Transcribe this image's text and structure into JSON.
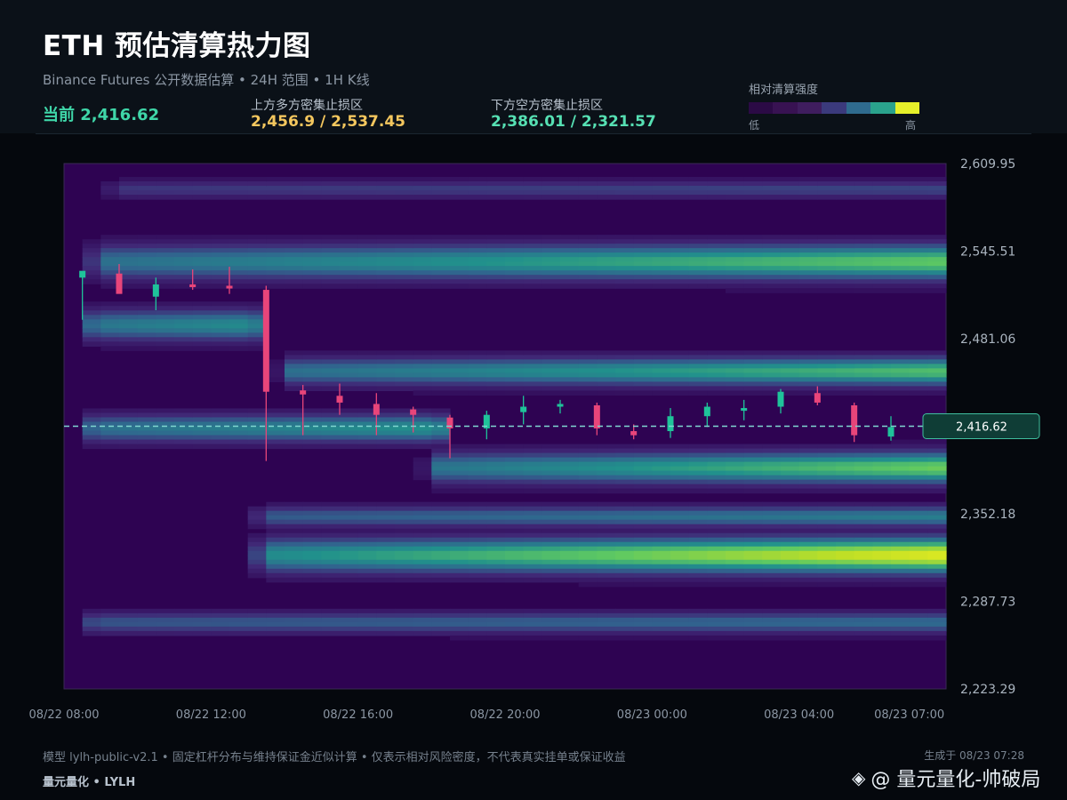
{
  "header": {
    "title": "ETH 预估清算热力图",
    "subtitle": "Binance Futures 公开数据估算 • 24H 范围 • 1H K线",
    "current_label": "当前 2,416.62",
    "upper_zone_label": "上方多方密集止损区",
    "upper_zone_value": "2,456.9 / 2,537.45",
    "lower_zone_label": "下方空方密集止损区",
    "lower_zone_value": "2,386.01 / 2,321.57"
  },
  "legend": {
    "title": "相对清算强度",
    "low": "低",
    "high": "高",
    "colors": [
      "#2b0a45",
      "#381252",
      "#3f1d5e",
      "#3b3a7c",
      "#2f6b8e",
      "#2aa28c",
      "#e6f02a"
    ]
  },
  "footer": {
    "note": "模型 lylh-public-v2.1 • 固定杠杆分布与维持保证金近似计算 • 仅表示相对风险密度，不代表真实挂单或保证收益",
    "brand": "量元量化 • LYLH",
    "generated": "生成于 08/23 07:28",
    "watermark": "@ 量元量化-帅破局"
  },
  "colors": {
    "up": "#1fc39a",
    "down": "#e8457a",
    "current_line": "#7fd6d0",
    "current_badge_bg": "#0f3d36"
  },
  "chart_data": {
    "type": "heatmap",
    "title": "ETH 预估清算热力图",
    "ylim": [
      2223.29,
      2609.95
    ],
    "y_ticks": [
      "2,609.95",
      "2,545.51",
      "2,481.06",
      "2,352.18",
      "2,287.73",
      "2,223.29"
    ],
    "y_tick_values": [
      2609.95,
      2545.51,
      2481.06,
      2352.18,
      2287.73,
      2223.29
    ],
    "x_ticks": [
      "08/22 08:00",
      "08/22 12:00",
      "08/22 16:00",
      "08/22 20:00",
      "08/23 00:00",
      "08/23 04:00",
      "08/23 07:00"
    ],
    "x_tick_hours": [
      0,
      4,
      8,
      12,
      16,
      20,
      23
    ],
    "current_price": 2416.62,
    "current_price_label": "2,416.62",
    "candles": [
      {
        "t": 0.5,
        "o": 2526,
        "h": 2528,
        "l": 2495,
        "c": 2531
      },
      {
        "t": 1.5,
        "o": 2529,
        "h": 2536,
        "l": 2515,
        "c": 2514
      },
      {
        "t": 2.5,
        "o": 2512,
        "h": 2526,
        "l": 2502,
        "c": 2521
      },
      {
        "t": 3.5,
        "o": 2521,
        "h": 2532,
        "l": 2517,
        "c": 2519
      },
      {
        "t": 4.5,
        "o": 2520,
        "h": 2534,
        "l": 2514,
        "c": 2518
      },
      {
        "t": 5.5,
        "o": 2517,
        "h": 2520,
        "l": 2391,
        "c": 2442
      },
      {
        "t": 6.5,
        "o": 2443,
        "h": 2447,
        "l": 2410,
        "c": 2440
      },
      {
        "t": 7.5,
        "o": 2439,
        "h": 2448,
        "l": 2425,
        "c": 2434
      },
      {
        "t": 8.5,
        "o": 2433,
        "h": 2441,
        "l": 2410,
        "c": 2425
      },
      {
        "t": 9.5,
        "o": 2429,
        "h": 2431,
        "l": 2412,
        "c": 2425
      },
      {
        "t": 10.5,
        "o": 2423,
        "h": 2425,
        "l": 2393,
        "c": 2415
      },
      {
        "t": 11.5,
        "o": 2415,
        "h": 2428,
        "l": 2407,
        "c": 2425
      },
      {
        "t": 12.5,
        "o": 2427,
        "h": 2439,
        "l": 2418,
        "c": 2431
      },
      {
        "t": 13.5,
        "o": 2431,
        "h": 2436,
        "l": 2426,
        "c": 2433
      },
      {
        "t": 14.5,
        "o": 2432,
        "h": 2434,
        "l": 2410,
        "c": 2415
      },
      {
        "t": 15.5,
        "o": 2413,
        "h": 2418,
        "l": 2407,
        "c": 2410
      },
      {
        "t": 16.5,
        "o": 2413,
        "h": 2430,
        "l": 2408,
        "c": 2424
      },
      {
        "t": 17.5,
        "o": 2424,
        "h": 2434,
        "l": 2416,
        "c": 2431
      },
      {
        "t": 18.5,
        "o": 2428,
        "h": 2436,
        "l": 2421,
        "c": 2430
      },
      {
        "t": 19.5,
        "o": 2431,
        "h": 2444,
        "l": 2426,
        "c": 2442
      },
      {
        "t": 20.5,
        "o": 2441,
        "h": 2446,
        "l": 2432,
        "c": 2434
      },
      {
        "t": 21.5,
        "o": 2432,
        "h": 2434,
        "l": 2405,
        "c": 2410
      },
      {
        "t": 22.5,
        "o": 2409,
        "h": 2424,
        "l": 2406,
        "c": 2416
      }
    ],
    "bands": [
      {
        "price": 2591,
        "start": 1.5,
        "sigma": 5,
        "intensity": [
          0.3,
          0.35
        ]
      },
      {
        "price": 2537.45,
        "start": 1.0,
        "sigma": 10,
        "intensity": [
          0.5,
          0.78
        ]
      },
      {
        "price": 2491,
        "start": 0.8,
        "end": 5.2,
        "sigma": 9,
        "intensity": [
          0.52,
          0.6
        ]
      },
      {
        "price": 2456.9,
        "start": 6.2,
        "sigma": 8,
        "intensity": [
          0.5,
          0.75
        ]
      },
      {
        "price": 2415,
        "start": 0.8,
        "end": 10.2,
        "sigma": 8,
        "intensity": [
          0.5,
          0.62
        ]
      },
      {
        "price": 2386.01,
        "start": 10.2,
        "sigma": 9,
        "intensity": [
          0.52,
          0.8
        ]
      },
      {
        "price": 2350,
        "start": 5.5,
        "sigma": 6,
        "intensity": [
          0.42,
          0.55
        ]
      },
      {
        "price": 2321.57,
        "start": 5.5,
        "sigma": 10,
        "intensity": [
          0.6,
          0.97
        ]
      },
      {
        "price": 2272,
        "start": 0.8,
        "sigma": 6,
        "intensity": [
          0.4,
          0.48
        ]
      }
    ]
  }
}
